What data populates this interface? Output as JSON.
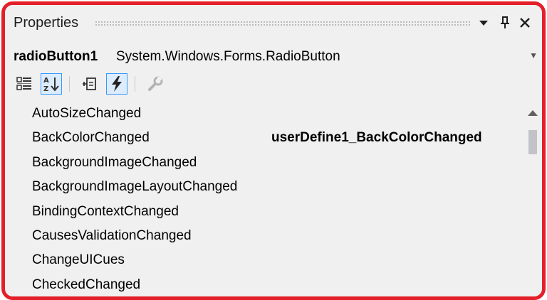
{
  "window": {
    "title": "Properties"
  },
  "selector": {
    "object_name": "radioButton1",
    "object_type": "System.Windows.Forms.RadioButton"
  },
  "toolbar": {
    "icons": [
      "categorized-icon",
      "alphabetical-icon",
      "properties-icon",
      "events-icon",
      "property-pages-icon"
    ],
    "active": [
      "alphabetical-icon",
      "events-icon"
    ]
  },
  "events": [
    {
      "name": "AutoSizeChanged",
      "handler": ""
    },
    {
      "name": "BackColorChanged",
      "handler": "userDefine1_BackColorChanged"
    },
    {
      "name": "BackgroundImageChanged",
      "handler": ""
    },
    {
      "name": "BackgroundImageLayoutChanged",
      "handler": ""
    },
    {
      "name": "BindingContextChanged",
      "handler": ""
    },
    {
      "name": "CausesValidationChanged",
      "handler": ""
    },
    {
      "name": "ChangeUICues",
      "handler": ""
    },
    {
      "name": "CheckedChanged",
      "handler": ""
    }
  ],
  "colors": {
    "highlight_border": "#e3202a",
    "active_tool_border": "#3399ff",
    "active_tool_fill": "#dcecfc"
  }
}
